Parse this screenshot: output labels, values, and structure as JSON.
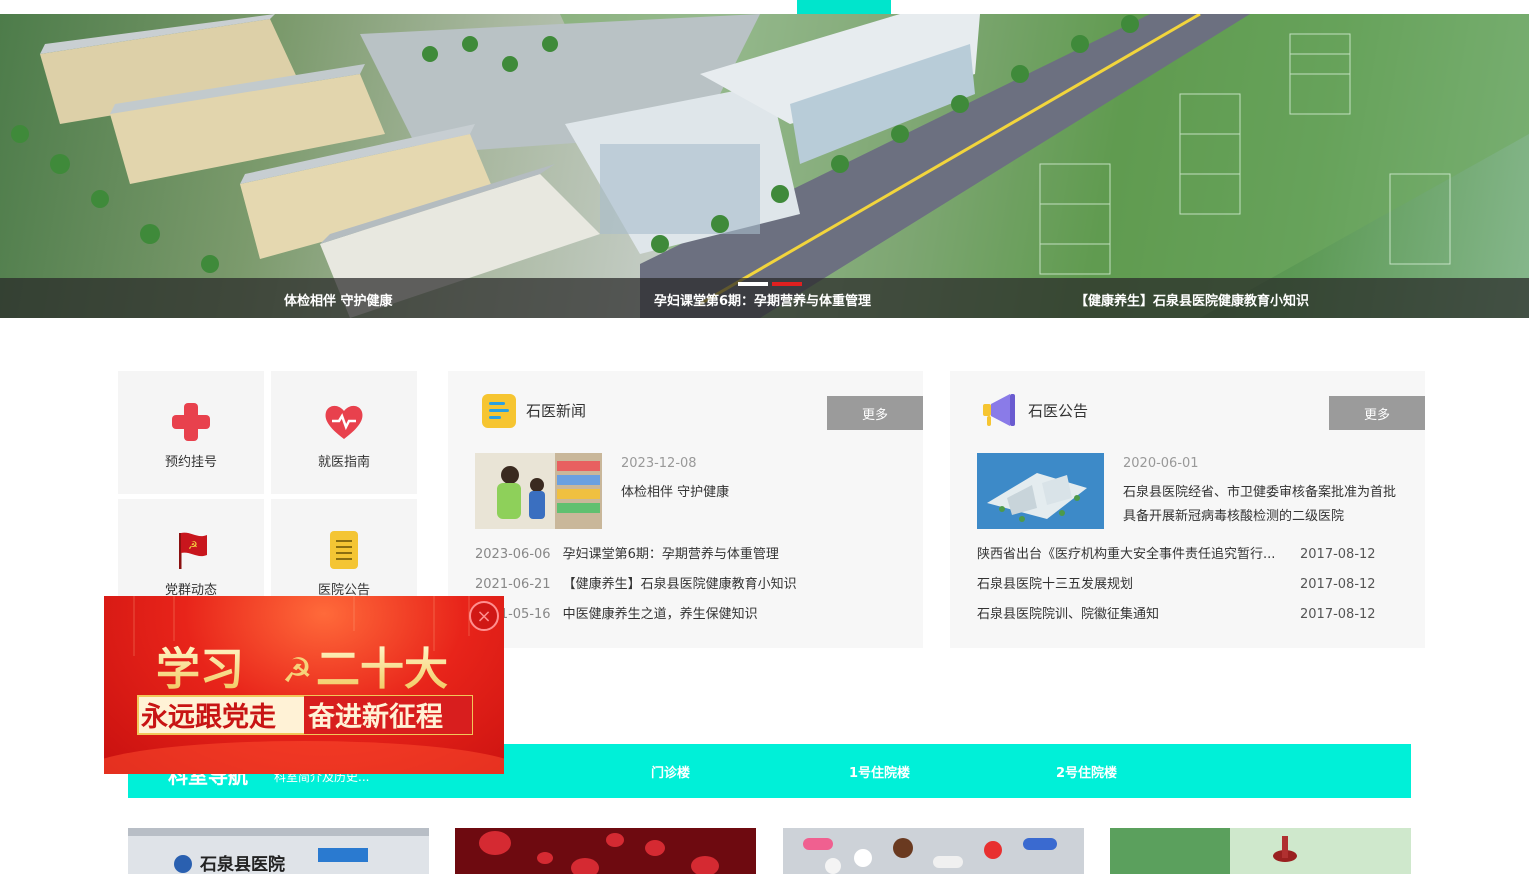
{
  "hero": {
    "captions": [
      "体检相伴 守护健康",
      "孕妇课堂第6期：孕期营养与体重管理",
      "【健康养生】石泉县医院健康教育小知识"
    ]
  },
  "quick_links": [
    {
      "label": "预约挂号",
      "icon": "red-cross-icon"
    },
    {
      "label": "就医指南",
      "icon": "heart-pulse-icon"
    },
    {
      "label": "党群动态",
      "icon": "party-flag-icon"
    },
    {
      "label": "医院公告",
      "icon": "notice-document-icon"
    }
  ],
  "news": {
    "title": "石医新闻",
    "more": "更多",
    "featured": {
      "date": "2023-12-08",
      "title": "体检相伴 守护健康"
    },
    "items": [
      {
        "date": "2023-06-06",
        "title": "孕妇课堂第6期：孕期营养与体重管理"
      },
      {
        "date": "2021-06-21",
        "title": "【健康养生】石泉县医院健康教育小知识"
      },
      {
        "date": "2021-05-16",
        "title": "中医健康养生之道，养生保健知识"
      }
    ]
  },
  "notice": {
    "title": "石医公告",
    "more": "更多",
    "featured": {
      "date": "2020-06-01",
      "title": "石泉县医院经省、市卫健委审核备案批准为首批具备开展新冠病毒核酸检测的二级医院"
    },
    "items": [
      {
        "title": "陕西省出台《医疗机构重大安全事件责任追究暂行...",
        "date": "2017-08-12"
      },
      {
        "title": "石泉县医院十三五发展规划",
        "date": "2017-08-12"
      },
      {
        "title": "石泉县医院院训、院徽征集通知",
        "date": "2017-08-12"
      }
    ]
  },
  "popup": {
    "line1a": "学习",
    "line1b": "二十大",
    "line2a": "永远跟党走",
    "line2b": "奋进新征程",
    "close": "×"
  },
  "dept": {
    "title": "科室导航",
    "subtitle": "科室简介及历史...",
    "links": [
      "门诊楼",
      "1号住院楼",
      "2号住院楼"
    ]
  },
  "cards": {
    "sign_text": "石泉县医院"
  },
  "colors": {
    "accent": "#00f0d8",
    "active_dot": "#ffffff",
    "dot_red": "#e02020",
    "more_button": "#9b9b9b"
  }
}
